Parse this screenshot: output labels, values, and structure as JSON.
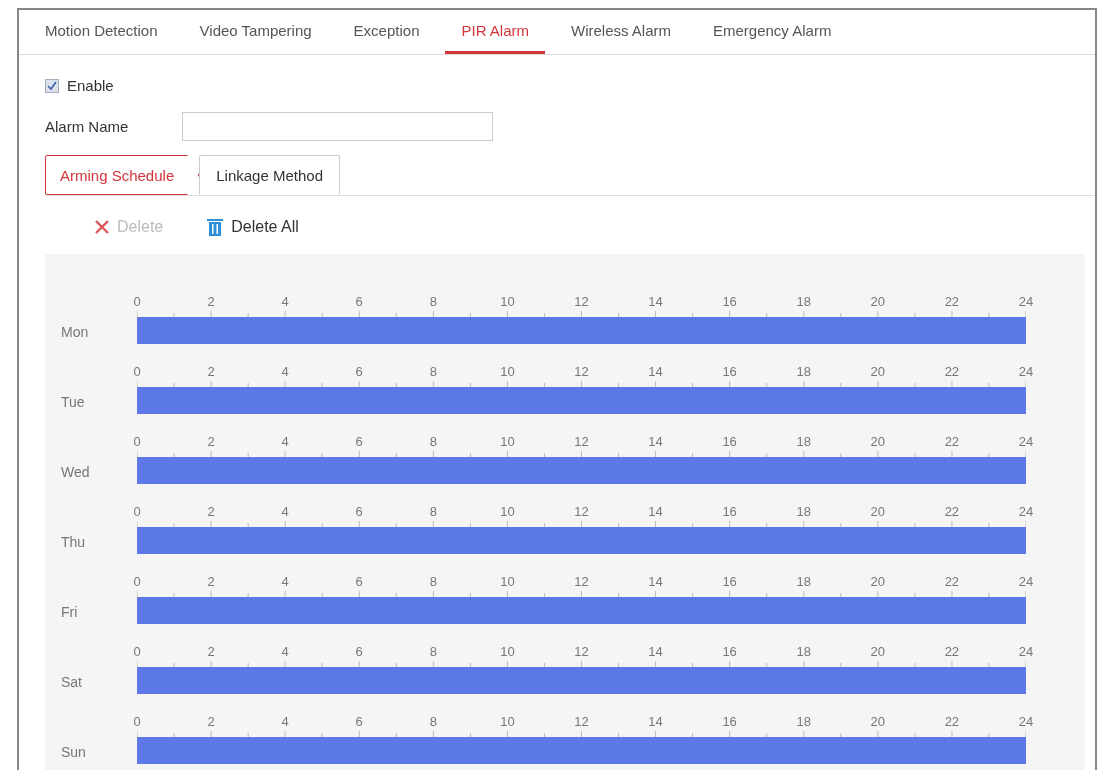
{
  "tabs": [
    {
      "label": "Motion Detection",
      "selected": false
    },
    {
      "label": "Video Tampering",
      "selected": false
    },
    {
      "label": "Exception",
      "selected": false
    },
    {
      "label": "PIR Alarm",
      "selected": true
    },
    {
      "label": "Wireless Alarm",
      "selected": false
    },
    {
      "label": "Emergency Alarm",
      "selected": false
    }
  ],
  "enable": {
    "label": "Enable",
    "checked": true
  },
  "alarm_name": {
    "label": "Alarm Name"
  },
  "subtabs": [
    {
      "label": "Arming Schedule",
      "selected": true
    },
    {
      "label": "Linkage Method",
      "selected": false
    }
  ],
  "actions": [
    {
      "kind": "delete",
      "label": "Delete",
      "disabled": true
    },
    {
      "kind": "delete_all",
      "label": "Delete All",
      "disabled": false
    }
  ],
  "schedule": [
    {
      "day": "Mon",
      "ticks": [
        "0",
        "2",
        "4",
        "6",
        "8",
        "10",
        "12",
        "14",
        "16",
        "18",
        "20",
        "22",
        "24"
      ],
      "level": 1
    },
    {
      "day": "Tue",
      "ticks": [
        "0",
        "2",
        "4",
        "6",
        "8",
        "10",
        "12",
        "14",
        "16",
        "18",
        "20",
        "22",
        "24"
      ],
      "level": 1
    },
    {
      "day": "Wed",
      "ticks": [
        "0",
        "2",
        "4",
        "6",
        "8",
        "10",
        "12",
        "14",
        "16",
        "18",
        "20",
        "22",
        "24"
      ],
      "level": 1
    },
    {
      "day": "Thu",
      "ticks": [
        "0",
        "2",
        "4",
        "6",
        "8",
        "10",
        "12",
        "14",
        "16",
        "18",
        "20",
        "22",
        "24"
      ],
      "level": 1
    },
    {
      "day": "Fri",
      "ticks": [
        "0",
        "2",
        "4",
        "6",
        "8",
        "10",
        "12",
        "14",
        "16",
        "18",
        "20",
        "22",
        "24"
      ],
      "level": 1
    },
    {
      "day": "Sat",
      "ticks": [
        "0",
        "2",
        "4",
        "6",
        "8",
        "10",
        "12",
        "14",
        "16",
        "18",
        "20",
        "22",
        "24"
      ],
      "level": 1
    },
    {
      "day": "Sun",
      "ticks": [
        "0",
        "2",
        "4",
        "6",
        "8",
        "10",
        "12",
        "14",
        "16",
        "18",
        "20",
        "22",
        "24"
      ],
      "level": 1
    }
  ]
}
